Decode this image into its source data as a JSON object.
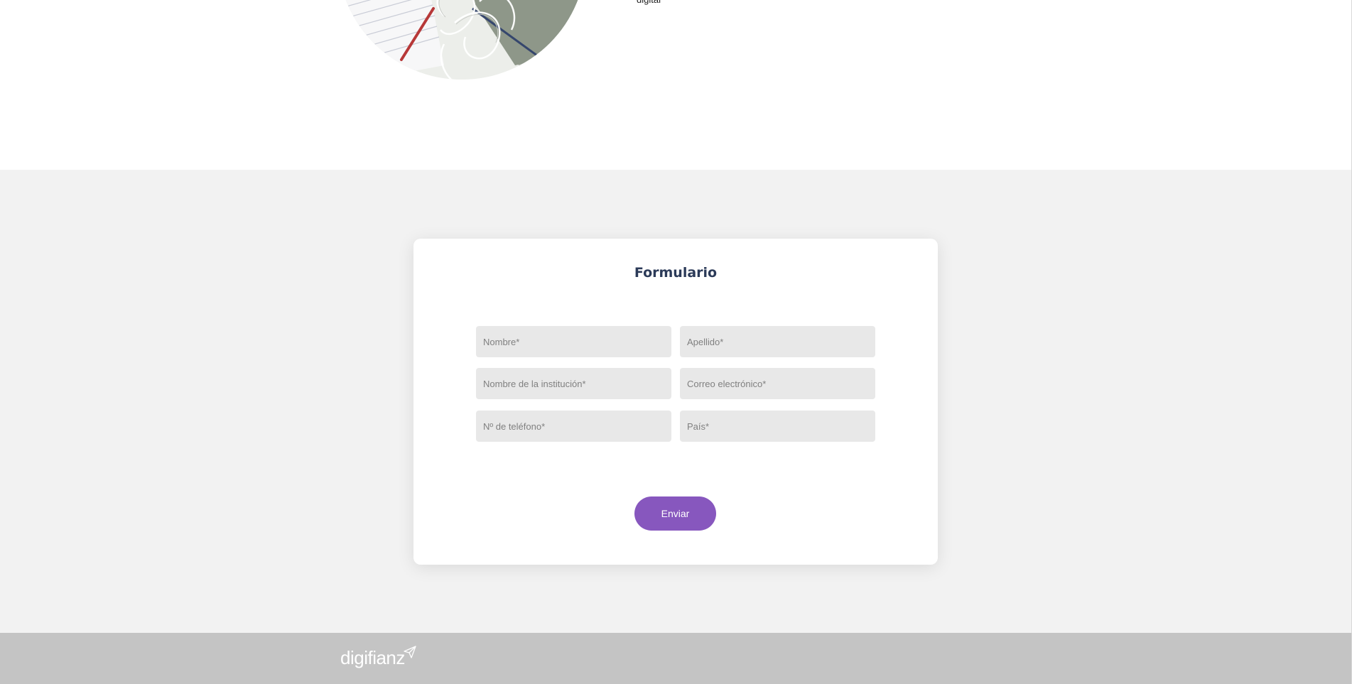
{
  "intro": {
    "text": "digital"
  },
  "form": {
    "title": "Formulario",
    "fields": {
      "first_name": {
        "placeholder": "Nombre*",
        "value": ""
      },
      "last_name": {
        "placeholder": "Apellido*",
        "value": ""
      },
      "institution": {
        "placeholder": "Nombre de la institución*",
        "value": ""
      },
      "email": {
        "placeholder": "Correo electrónico*",
        "value": ""
      },
      "phone": {
        "placeholder": "Nº de teléfono*",
        "value": ""
      },
      "country": {
        "placeholder": "País*",
        "value": ""
      }
    },
    "submit_label": "Enviar"
  },
  "footer": {
    "logo_text": "digifianz",
    "logo_icon": "paper-plane-icon"
  },
  "colors": {
    "accent": "#8757be",
    "title": "#2b3a58",
    "section_bg": "#f2f2f2",
    "field_bg": "#e8e8e8",
    "footer_bg": "#c4c4c4"
  }
}
